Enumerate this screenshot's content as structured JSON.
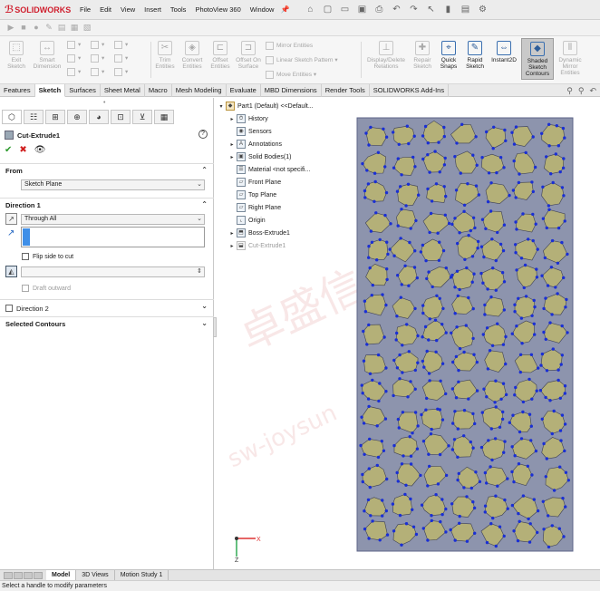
{
  "app": {
    "brand": "SOLIDWORKS",
    "menus": [
      "File",
      "Edit",
      "View",
      "Insert",
      "Tools",
      "PhotoView 360",
      "Window"
    ]
  },
  "ribbon": {
    "exit_sketch": "Exit Sketch",
    "smart_dimension": "Smart Dimension",
    "trim_entities": "Trim Entities",
    "convert_entities": "Convert Entities",
    "offset_entities": "Offset Entities",
    "offset_on_surface": "Offset On Surface",
    "mirror_entities": "Mirror Entities",
    "linear_sketch_pattern": "Linear Sketch Pattern",
    "move_entities": "Move Entities",
    "display_delete_relations": "Display/Delete Relations",
    "repair_sketch": "Repair Sketch",
    "quick_snaps": "Quick Snaps",
    "rapid_sketch": "Rapid Sketch",
    "instant2d": "Instant2D",
    "shaded_sketch_contours": "Shaded Sketch Contours",
    "dynamic_mirror_entities": "Dynamic Mirror Entities"
  },
  "tabs": [
    "Features",
    "Sketch",
    "Surfaces",
    "Sheet Metal",
    "Macro",
    "Mesh Modeling",
    "Evaluate",
    "MBD Dimensions",
    "Render Tools",
    "SOLIDWORKS Add-Ins"
  ],
  "active_tab": "Sketch",
  "property_manager": {
    "title": "Cut-Extrude1",
    "from_label": "From",
    "from_value": "Sketch Plane",
    "direction1_label": "Direction 1",
    "end_condition": "Through All",
    "flip_side_label": "Flip side to cut",
    "draft_outward_label": "Draft outward",
    "direction2_label": "Direction 2",
    "selected_contours_label": "Selected Contours"
  },
  "feature_tree": {
    "root": "Part1 (Default) <<Default...",
    "items": [
      "History",
      "Sensors",
      "Annotations",
      "Solid Bodies(1)",
      "Material <not specifi...",
      "Front Plane",
      "Top Plane",
      "Right Plane",
      "Origin",
      "Boss-Extrude1",
      "Cut-Extrude1"
    ]
  },
  "triad": {
    "x_label": "X",
    "z_label": "Z"
  },
  "bottom_tabs": [
    "Model",
    "3D Views",
    "Motion Study 1"
  ],
  "active_bottom_tab": "Model",
  "status_text": "Select a handle to modify parameters",
  "colors": {
    "brand_red": "#d01f2e",
    "plate_face": "#b4b078",
    "plate_gap": "#8d94ad",
    "sketch_blue": "#1a2fd4"
  }
}
